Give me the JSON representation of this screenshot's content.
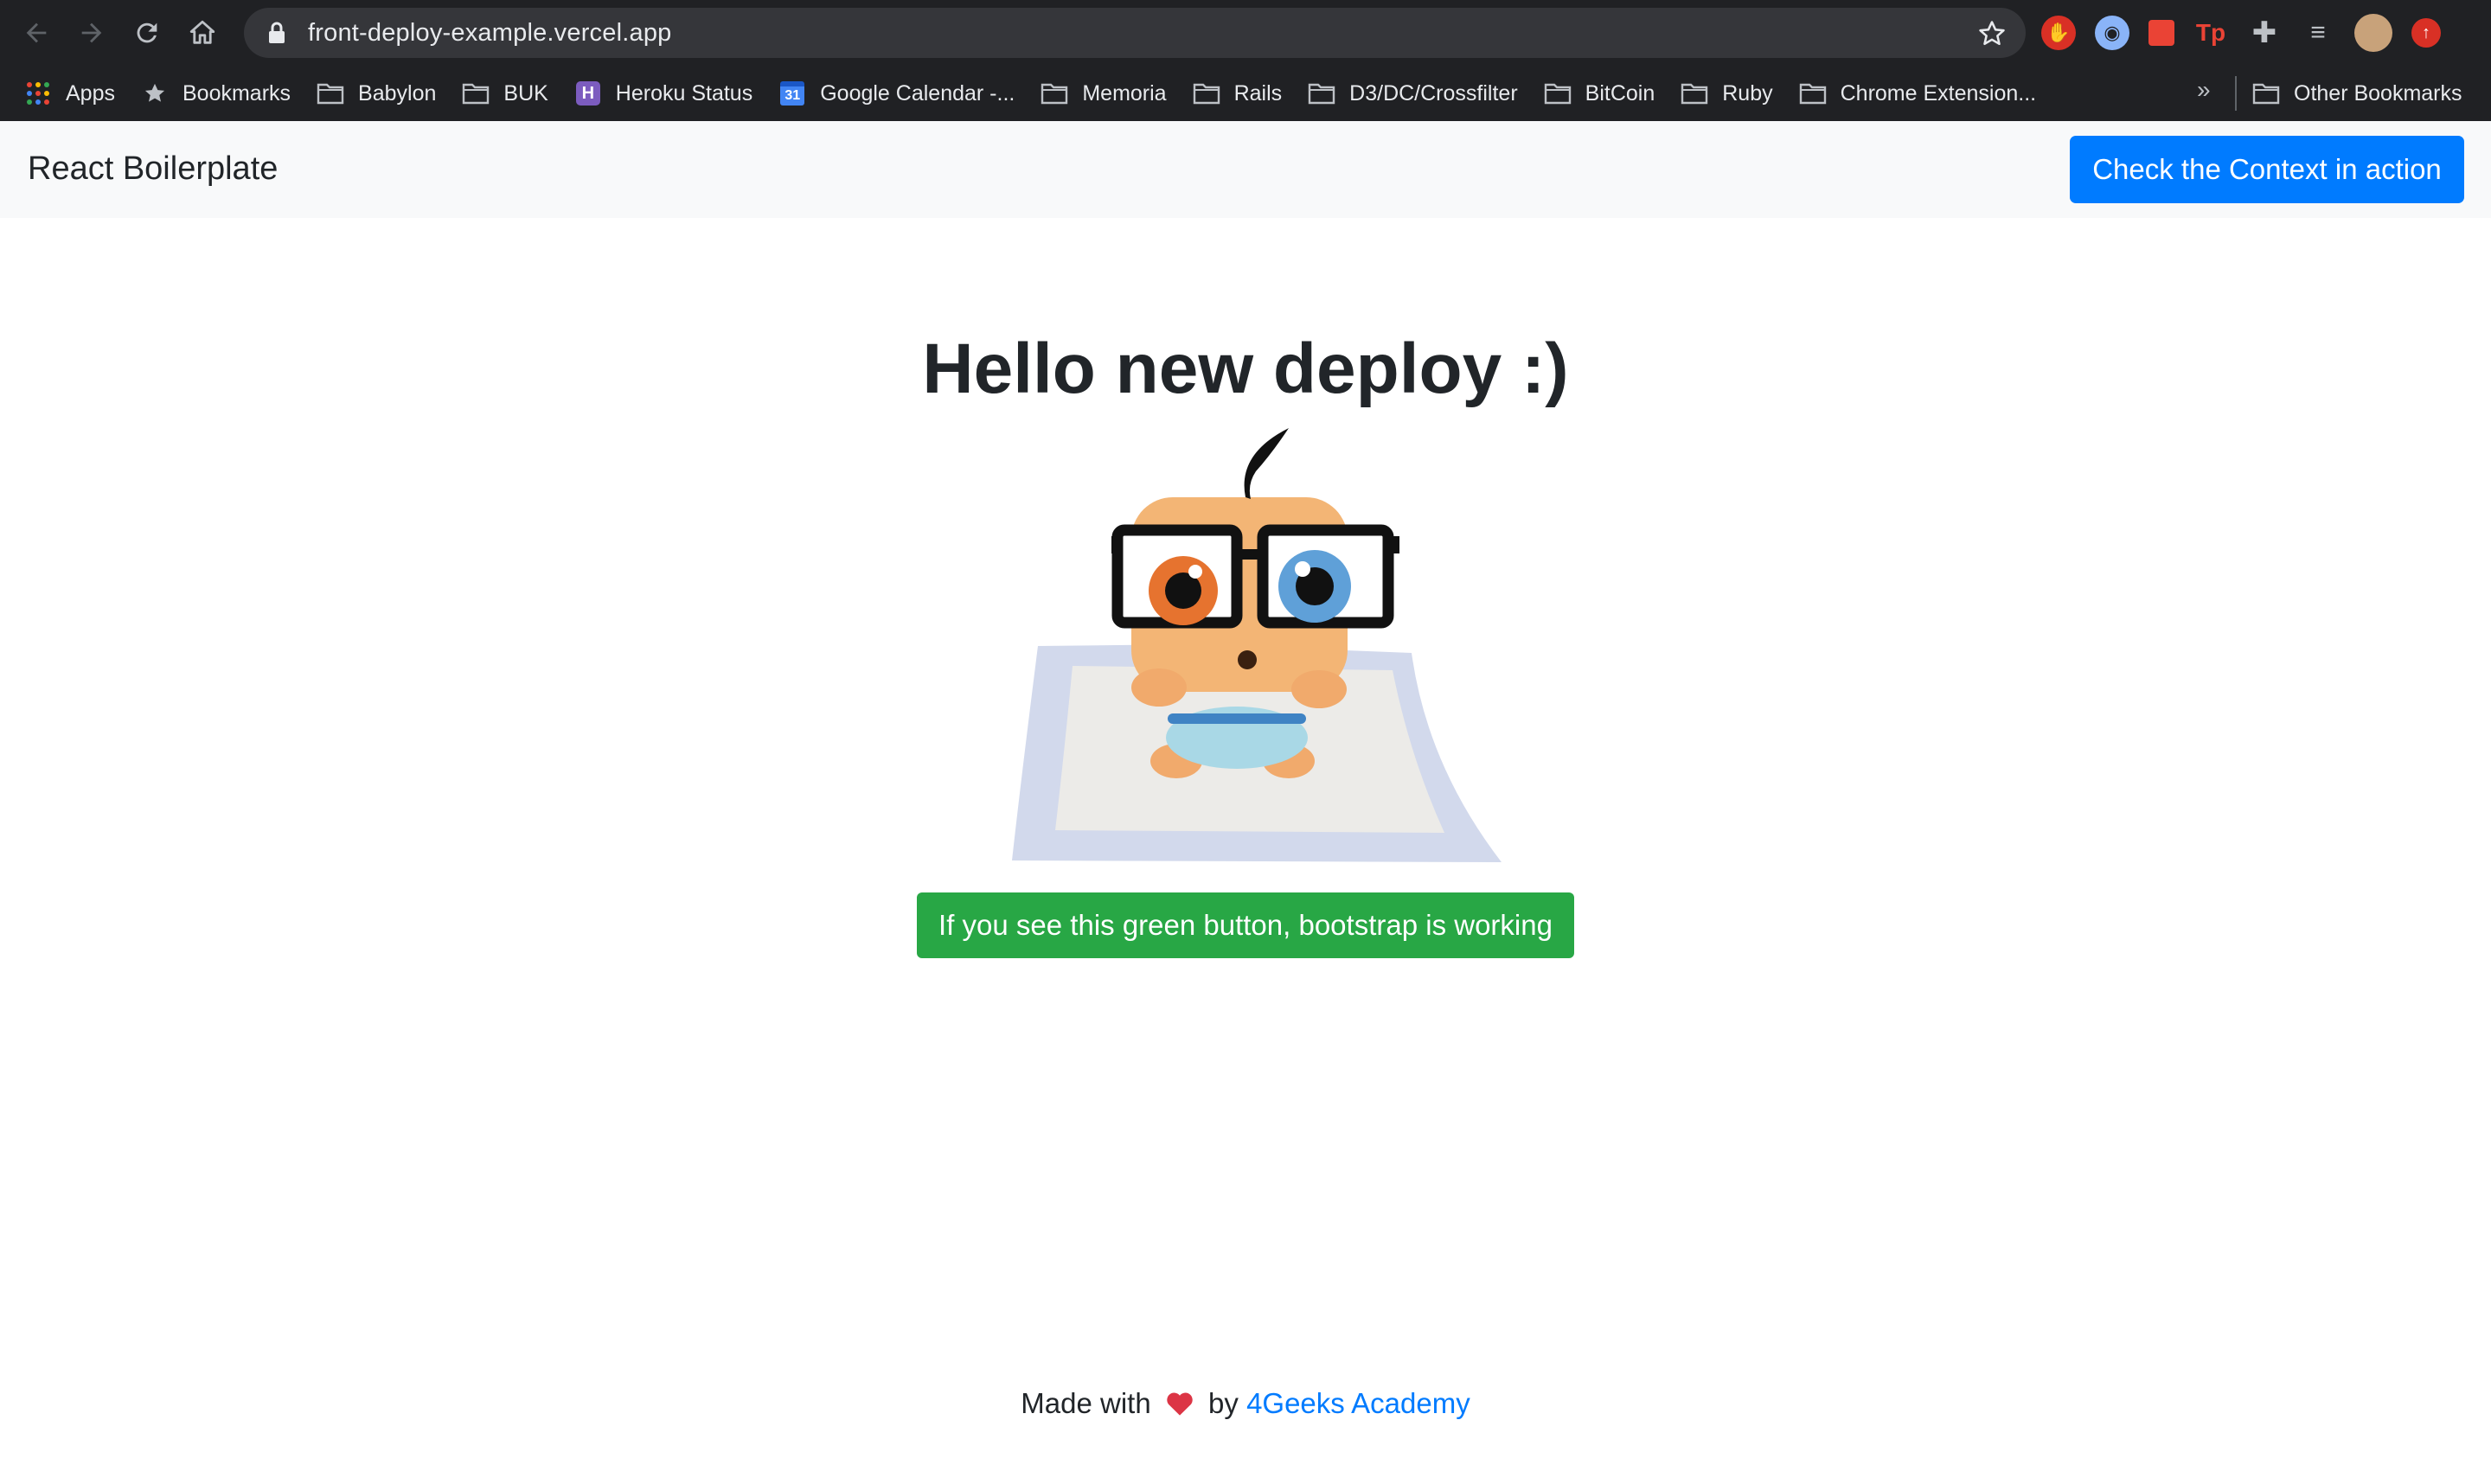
{
  "browser": {
    "url": "front-deploy-example.vercel.app",
    "bookmarks": [
      {
        "label": "Apps",
        "icon": "apps-grid-icon"
      },
      {
        "label": "Bookmarks",
        "icon": "star-icon"
      },
      {
        "label": "Babylon",
        "icon": "folder-icon"
      },
      {
        "label": "BUK",
        "icon": "folder-icon"
      },
      {
        "label": "Heroku Status",
        "icon": "heroku-icon"
      },
      {
        "label": "Google Calendar -...",
        "icon": "calendar-icon"
      },
      {
        "label": "Memoria",
        "icon": "folder-icon"
      },
      {
        "label": "Rails",
        "icon": "folder-icon"
      },
      {
        "label": "D3/DC/Crossfilter",
        "icon": "folder-icon"
      },
      {
        "label": "BitCoin",
        "icon": "folder-icon"
      },
      {
        "label": "Ruby",
        "icon": "folder-icon"
      },
      {
        "label": "Chrome Extension...",
        "icon": "folder-icon"
      }
    ],
    "overflow": "»",
    "other_bookmarks": "Other Bookmarks",
    "calendar_day": "31",
    "heroku_letter": "H",
    "ext_tp": "Tp"
  },
  "navbar": {
    "brand": "React Boilerplate",
    "context_button": "Check the Context in action"
  },
  "main": {
    "title": "Hello new deploy :)",
    "green_button": "If you see this green button, bootstrap is working"
  },
  "footer": {
    "made_with": "Made with",
    "by": "by",
    "link": "4Geeks Academy"
  },
  "colors": {
    "primary": "#007bff",
    "success": "#28a745",
    "navbar_bg": "#f8f9fa",
    "chrome_bg": "#202124",
    "heart": "#dc3545"
  }
}
